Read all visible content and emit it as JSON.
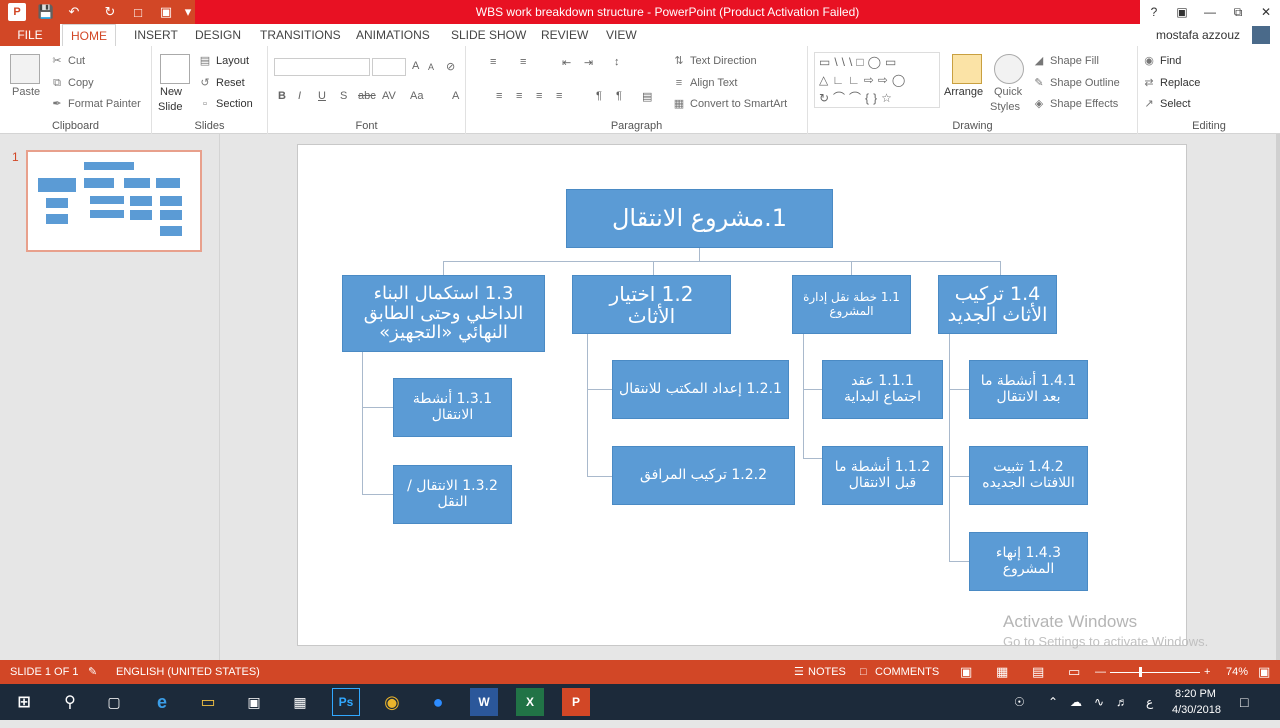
{
  "window": {
    "title": "WBS work breakdown structure - PowerPoint (Product Activation Failed)",
    "help": "?",
    "logo": "P"
  },
  "tabs": {
    "file": "FILE",
    "items": [
      "HOME",
      "INSERT",
      "DESIGN",
      "TRANSITIONS",
      "ANIMATIONS",
      "SLIDE SHOW",
      "REVIEW",
      "VIEW"
    ],
    "user": "mostafa azzouz"
  },
  "ribbon": {
    "clipboard": {
      "name": "Clipboard",
      "paste": "Paste",
      "cut": "Cut",
      "copy": "Copy",
      "format_painter": "Format Painter"
    },
    "slides": {
      "name": "Slides",
      "new_slide": "New",
      "new_slide2": "Slide",
      "layout": "Layout",
      "reset": "Reset",
      "section": "Section"
    },
    "font": {
      "name": "Font",
      "bold": "B",
      "italic": "I",
      "underline": "U",
      "shadow": "S",
      "strike": "abc",
      "spacing": "AV",
      "case": "Aa",
      "color": "A",
      "grow": "A",
      "shrink": "A"
    },
    "paragraph": {
      "name": "Paragraph",
      "text_direction": "Text Direction",
      "align_text": "Align Text",
      "convert_smartart": "Convert to SmartArt"
    },
    "drawing": {
      "name": "Drawing",
      "arrange": "Arrange",
      "quick_styles": "Quick",
      "quick_styles2": "Styles",
      "shape_fill": "Shape Fill",
      "shape_outline": "Shape Outline",
      "shape_effects": "Shape Effects"
    },
    "editing": {
      "name": "Editing",
      "find": "Find",
      "replace": "Replace",
      "select": "Select"
    }
  },
  "thumbnail": {
    "number": "1"
  },
  "wbs": {
    "root": "1.مشروع الانتقال",
    "c13": "1.3 استكمال البناء الداخلي وحتى الطابق النهائي «التجهيز»",
    "c12": "1.2 اختيار الأثاث",
    "c11": "1.1 خطة نقل إدارة المشروع",
    "c14": "1.4 تركيب الأثاث الجديد",
    "c131": "1.3.1 أنشطة الانتقال",
    "c132": "1.3.2 الانتقال / النقل",
    "c121": "1.2.1 إعداد المكتب للانتقال",
    "c122": "1.2.2 تركيب المرافق",
    "c111": "1.1.1 عقد اجتماع البداية",
    "c112": "1.1.2 أنشطة ما قبل الانتقال",
    "c141": "1.4.1 أنشطة ما بعد الانتقال",
    "c142": "1.4.2 تثبيت اللافتات الجديده",
    "c143": "1.4.3 إنهاء المشروع"
  },
  "watermark": {
    "line1": "Activate Windows",
    "line2": "Go to Settings to activate Windows."
  },
  "status": {
    "slide": "SLIDE 1 OF 1",
    "language": "ENGLISH (UNITED STATES)",
    "notes": "NOTES",
    "comments": "COMMENTS",
    "zoom": "74%"
  },
  "taskbar": {
    "time": "8:20 PM",
    "date": "4/30/2018",
    "lang": "ع",
    "apps": [
      "Ps",
      "W",
      "X",
      "P"
    ]
  },
  "colors": {
    "accent": "#d24726",
    "node": "#5b9bd5",
    "taskbar": "#1c2a3a"
  }
}
